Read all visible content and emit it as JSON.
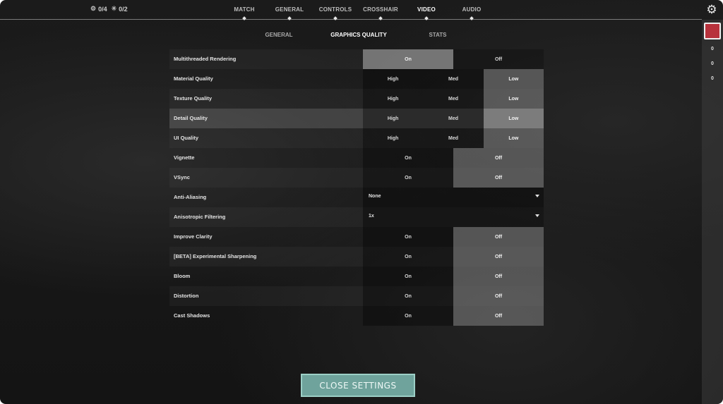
{
  "counters": [
    {
      "icon": "settings-icon",
      "text": "0/4"
    },
    {
      "icon": "spark-icon",
      "text": "0/2"
    }
  ],
  "main_tabs": [
    {
      "label": "MATCH",
      "active": false
    },
    {
      "label": "GENERAL",
      "active": false
    },
    {
      "label": "CONTROLS",
      "active": false
    },
    {
      "label": "CROSSHAIR",
      "active": false
    },
    {
      "label": "VIDEO",
      "active": true
    },
    {
      "label": "AUDIO",
      "active": false
    }
  ],
  "sub_tabs": [
    {
      "label": "GENERAL",
      "active": false
    },
    {
      "label": "GRAPHICS QUALITY",
      "active": true
    },
    {
      "label": "STATS",
      "active": false
    }
  ],
  "settings": [
    {
      "label": "Multithreaded Rendering",
      "type": "toggle",
      "options": [
        "On",
        "Off"
      ],
      "selected": "On"
    },
    {
      "label": "Material Quality",
      "type": "triple",
      "options": [
        "High",
        "Med",
        "Low"
      ],
      "selected": "Low"
    },
    {
      "label": "Texture Quality",
      "type": "triple",
      "options": [
        "High",
        "Med",
        "Low"
      ],
      "selected": "Low"
    },
    {
      "label": "Detail Quality",
      "type": "triple",
      "options": [
        "High",
        "Med",
        "Low"
      ],
      "selected": "Low"
    },
    {
      "label": "UI Quality",
      "type": "triple",
      "options": [
        "High",
        "Med",
        "Low"
      ],
      "selected": "Low"
    },
    {
      "label": "Vignette",
      "type": "toggle",
      "options": [
        "On",
        "Off"
      ],
      "selected": "Off"
    },
    {
      "label": "VSync",
      "type": "toggle",
      "options": [
        "On",
        "Off"
      ],
      "selected": "Off"
    },
    {
      "label": "Anti-Aliasing",
      "type": "dropdown",
      "value": "None"
    },
    {
      "label": "Anisotropic Filtering",
      "type": "dropdown",
      "value": "1x"
    },
    {
      "label": "Improve Clarity",
      "type": "toggle",
      "options": [
        "On",
        "Off"
      ],
      "selected": "Off"
    },
    {
      "label": "[BETA] Experimental Sharpening",
      "type": "toggle",
      "options": [
        "On",
        "Off"
      ],
      "selected": "Off"
    },
    {
      "label": "Bloom",
      "type": "toggle",
      "options": [
        "On",
        "Off"
      ],
      "selected": "Off"
    },
    {
      "label": "Distortion",
      "type": "toggle",
      "options": [
        "On",
        "Off"
      ],
      "selected": "Off"
    },
    {
      "label": "Cast Shadows",
      "type": "toggle",
      "options": [
        "On",
        "Off"
      ],
      "selected": "Off"
    }
  ],
  "highlighted_row": "Detail Quality",
  "rail": {
    "counts": [
      "0",
      "0",
      "0"
    ]
  },
  "close_button": "CLOSE SETTINGS",
  "colors": {
    "accent_button": "#6fa39c",
    "rail_logo": "#b8323c"
  }
}
